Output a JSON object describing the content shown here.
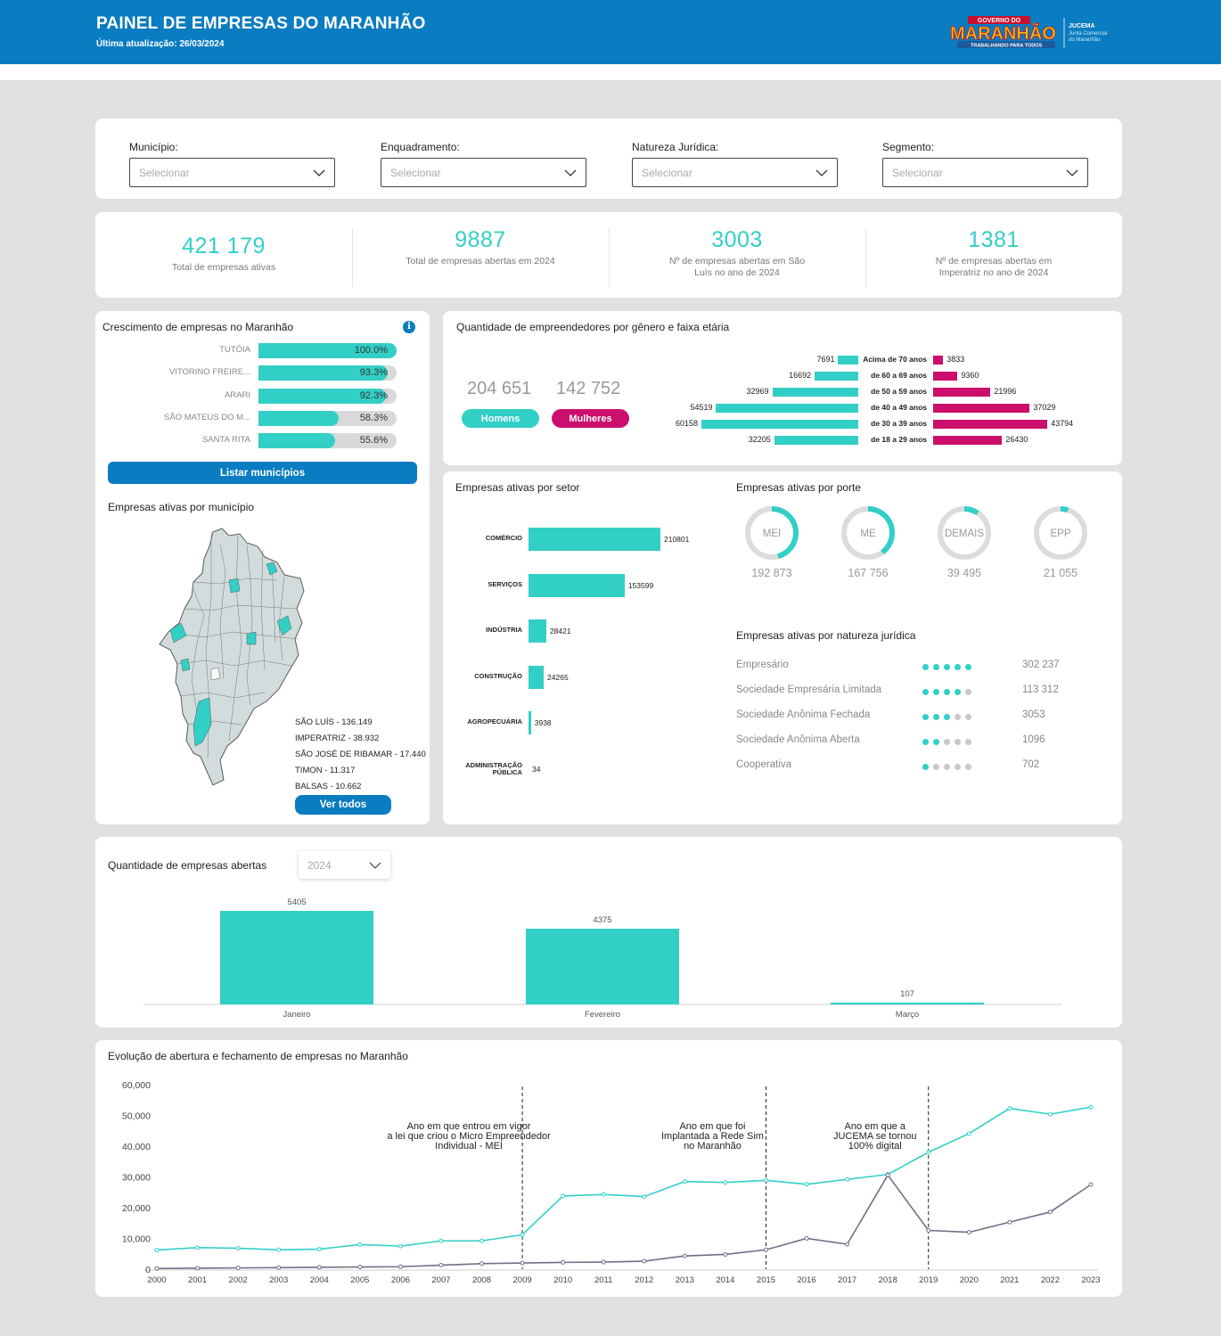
{
  "header": {
    "title": "PAINEL DE EMPRESAS DO MARANHÃO",
    "updated": "Última atualização: 26/03/2024",
    "logo_gov": "GOVERNO DO",
    "logo_state": "MARANHÃO",
    "logo_slogan": "TRABALHANDO PARA TODOS",
    "logo_org": "JUCEMA",
    "logo_org_full_1": "Junta Comercial",
    "logo_org_full_2": "do Maranhão"
  },
  "filters": [
    {
      "label": "Município:",
      "placeholder": "Selecionar"
    },
    {
      "label": "Enquadramento:",
      "placeholder": "Selecionar"
    },
    {
      "label": "Natureza Jurídica:",
      "placeholder": "Selecionar"
    },
    {
      "label": "Segmento:",
      "placeholder": "Selecionar"
    }
  ],
  "kpis": [
    {
      "value": "421 179",
      "label": "Total de empresas ativas"
    },
    {
      "value": "9887",
      "label": "Total de empresas abertas em 2024"
    },
    {
      "value": "3003",
      "label": "Nº de empresas abertas em São Luís no ano de 2024"
    },
    {
      "value": "1381",
      "label": "Nº de empresas abertas em Imperatriz no ano de 2024"
    }
  ],
  "growth": {
    "title": "Crescimento de empresas no Maranhão",
    "rows": [
      {
        "name": "TUTÓIA",
        "pct_label": "100.0%",
        "pct": 100.0
      },
      {
        "name": "VITORINO FREIRE...",
        "pct_label": "93.3%",
        "pct": 93.3
      },
      {
        "name": "ARARI",
        "pct_label": "92.3%",
        "pct": 92.3
      },
      {
        "name": "SÃO MATEUS DO M...",
        "pct_label": "58.3%",
        "pct": 58.3
      },
      {
        "name": "SANTA RITA",
        "pct_label": "55.6%",
        "pct": 55.6
      }
    ],
    "button": "Listar municípios"
  },
  "map": {
    "title": "Empresas ativas por município",
    "items": [
      "SÃO LUÍS - 136.149",
      "IMPERATRIZ - 38.932",
      "SÃO JOSÉ DE RIBAMAR - 17.440",
      "TIMON - 11.317",
      "BALSAS - 10.662"
    ],
    "button": "Ver todos"
  },
  "gender": {
    "title": "Quantidade de empreendedores por gênero e faixa etária",
    "men_total": "204 651",
    "women_total": "142 752",
    "men_label": "Homens",
    "women_label": "Mulheres",
    "colors": {
      "men": "#32cfc6",
      "women": "#cc0e6d"
    },
    "ages": [
      {
        "label": "Acima de 70 anos",
        "men": 7691,
        "women": 3833
      },
      {
        "label": "de 60 a 69 anos",
        "men": 16692,
        "women": 9360
      },
      {
        "label": "de 50 a 59 anos",
        "men": 32969,
        "women": 21996
      },
      {
        "label": "de 40 a 49 anos",
        "men": 54519,
        "women": 37029
      },
      {
        "label": "de 30 a 39 anos",
        "men": 60158,
        "women": 43794
      },
      {
        "label": "de 18 a 29 anos",
        "men": 32205,
        "women": 26430
      }
    ]
  },
  "sector": {
    "title": "Empresas ativas por setor",
    "rows": [
      {
        "name": "COMÉRCIO",
        "value": 210801
      },
      {
        "name": "SERVIÇOS",
        "value": 153599
      },
      {
        "name": "INDÚSTRIA",
        "value": 28421
      },
      {
        "name": "CONSTRUÇÃO",
        "value": 24265
      },
      {
        "name": "AGROPECUÁRIA",
        "value": 3938
      },
      {
        "name": "ADMINISTRAÇÃO PÚBLICA",
        "value": 34
      }
    ]
  },
  "porte": {
    "title": "Empresas ativas por porte",
    "items": [
      {
        "name": "MEI",
        "value": "192 873",
        "fraction": 0.458
      },
      {
        "name": "ME",
        "value": "167 756",
        "fraction": 0.398
      },
      {
        "name": "DEMAIS",
        "value": "39 495",
        "fraction": 0.094
      },
      {
        "name": "EPP",
        "value": "21 055",
        "fraction": 0.05
      }
    ]
  },
  "natureza": {
    "title": "Empresas ativas por natureza jurídica",
    "rows": [
      {
        "name": "Empresário",
        "value": "302 237",
        "dots": 5
      },
      {
        "name": "Sociedade Empresária Limitada",
        "value": "113 312",
        "dots": 4
      },
      {
        "name": "Sociedade Anônima Fechada",
        "value": "3053",
        "dots": 3
      },
      {
        "name": "Sociedade Anônima Aberta",
        "value": "1096",
        "dots": 2
      },
      {
        "name": "Cooperativa",
        "value": "702",
        "dots": 1
      }
    ]
  },
  "monthly": {
    "title": "Quantidade de empresas abertas",
    "year": "2024",
    "chart_data": {
      "type": "bar",
      "categories": [
        "Janeiro",
        "Fevereiro",
        "Março"
      ],
      "values": [
        5405,
        4375,
        107
      ],
      "ylim": [
        0,
        5405
      ]
    }
  },
  "evolution": {
    "title": "Evolução de abertura e fechamento de empresas no Maranhão",
    "annotations": [
      {
        "x": 2009,
        "text": [
          "Ano em que entrou em vigor",
          "a lei que criou o Micro Empreendedor",
          "Individual - MEI"
        ]
      },
      {
        "x": 2015,
        "text": [
          "Ano em que foi",
          "Implantada a Rede Sim",
          "no Maranhão"
        ]
      },
      {
        "x": 2019,
        "text": [
          "Ano em que a",
          "JUCEMA se tornou",
          "100% digital"
        ]
      }
    ],
    "chart_data": {
      "type": "line",
      "x": [
        2000,
        2001,
        2002,
        2003,
        2004,
        2005,
        2006,
        2007,
        2008,
        2009,
        2010,
        2011,
        2012,
        2013,
        2014,
        2015,
        2016,
        2017,
        2018,
        2019,
        2020,
        2021,
        2022,
        2023
      ],
      "yticks": [
        "0",
        "10,000",
        "20,000",
        "30,000",
        "40,000",
        "50,000",
        "60,000"
      ],
      "ylim": [
        0,
        60000
      ],
      "series": [
        {
          "color": "#32cfc6",
          "values": [
            6200,
            7000,
            6800,
            6300,
            6500,
            8000,
            7500,
            9200,
            9200,
            11200,
            23800,
            24300,
            23600,
            28500,
            28200,
            28900,
            27600,
            29200,
            30800,
            38000,
            44100,
            52300,
            50400,
            52700
          ]
        },
        {
          "color": "#6b7186",
          "values": [
            200,
            300,
            400,
            500,
            600,
            700,
            800,
            1300,
            1800,
            2000,
            2200,
            2300,
            2600,
            4300,
            4800,
            6300,
            10000,
            8100,
            30600,
            12600,
            12000,
            15300,
            18600,
            27500
          ]
        }
      ]
    }
  }
}
